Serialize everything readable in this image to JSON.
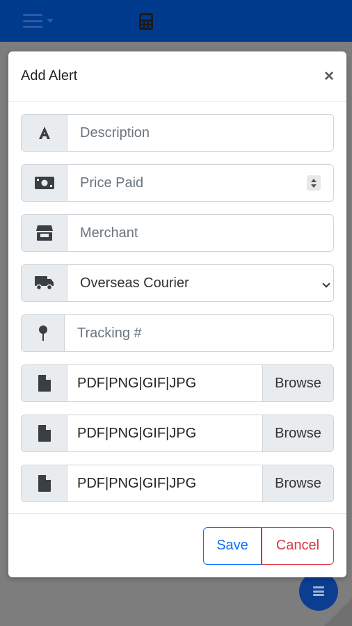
{
  "modal": {
    "title": "Add Alert",
    "close_label": "×"
  },
  "form": {
    "description": {
      "placeholder": "Description",
      "icon": "font-icon"
    },
    "price_paid": {
      "placeholder": "Price Paid",
      "icon": "money-bill-icon"
    },
    "merchant": {
      "placeholder": "Merchant",
      "icon": "store-icon"
    },
    "shipping": {
      "selected": "Overseas Courier",
      "icon": "truck-icon"
    },
    "tracking": {
      "placeholder": "Tracking #",
      "icon": "map-pin-icon"
    },
    "files": [
      {
        "text": "PDF|PNG|GIF|JPG",
        "browse_label": "Browse",
        "icon": "file-icon"
      },
      {
        "text": "PDF|PNG|GIF|JPG",
        "browse_label": "Browse",
        "icon": "file-icon"
      },
      {
        "text": "PDF|PNG|GIF|JPG",
        "browse_label": "Browse",
        "icon": "file-icon"
      }
    ]
  },
  "footer": {
    "save_label": "Save",
    "cancel_label": "Cancel"
  },
  "colors": {
    "navbar": "#003a8c",
    "save": "#0d6efd",
    "cancel": "#dc3545",
    "addon_bg": "#e9ecef"
  }
}
